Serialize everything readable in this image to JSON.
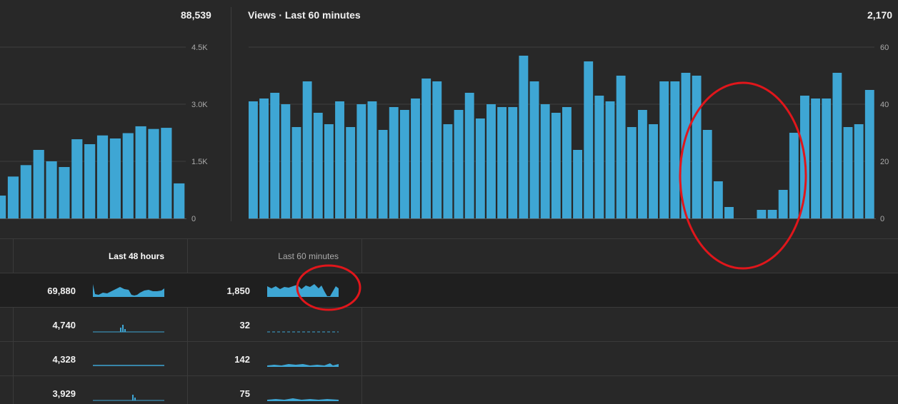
{
  "colors": {
    "bar": "#3ea6d4",
    "grid": "#3e3e3e",
    "annotation": "#e0161b",
    "background": "#282828"
  },
  "left_panel": {
    "total": "88,539"
  },
  "right_panel": {
    "title": "Views · Last 60 minutes",
    "total": "2,170"
  },
  "table": {
    "header_48h": "Last 48 hours",
    "header_60m": "Last 60 minutes",
    "rows": [
      {
        "h48": "69,880",
        "m60": "1,850"
      },
      {
        "h48": "4,740",
        "m60": "32"
      },
      {
        "h48": "4,328",
        "m60": "142"
      },
      {
        "h48": "3,929",
        "m60": "75"
      }
    ]
  },
  "chart_data": [
    {
      "type": "bar",
      "ylim": [
        0,
        4500
      ],
      "y_ticks": [
        "0",
        "1.5K",
        "3.0K",
        "4.5K"
      ],
      "values": [
        600,
        1100,
        1400,
        1800,
        1500,
        1350,
        2080,
        1950,
        2180,
        2100,
        2240,
        2420,
        2350,
        2380,
        920
      ],
      "grid": true
    },
    {
      "type": "bar",
      "title": "Views · Last 60 minutes",
      "ylim": [
        0,
        60
      ],
      "y_ticks": [
        "0",
        "20",
        "40",
        "60"
      ],
      "values": [
        41,
        42,
        44,
        40,
        32,
        48,
        37,
        33,
        41,
        32,
        40,
        41,
        31,
        39,
        38,
        42,
        49,
        48,
        33,
        38,
        44,
        35,
        40,
        39,
        39,
        57,
        48,
        40,
        37,
        39,
        24,
        55,
        43,
        41,
        50,
        32,
        38,
        33,
        48,
        48,
        51,
        50,
        31,
        13,
        4,
        0,
        0,
        3,
        3,
        10,
        30,
        43,
        42,
        42,
        51,
        32,
        33,
        45
      ],
      "grid": true
    }
  ]
}
